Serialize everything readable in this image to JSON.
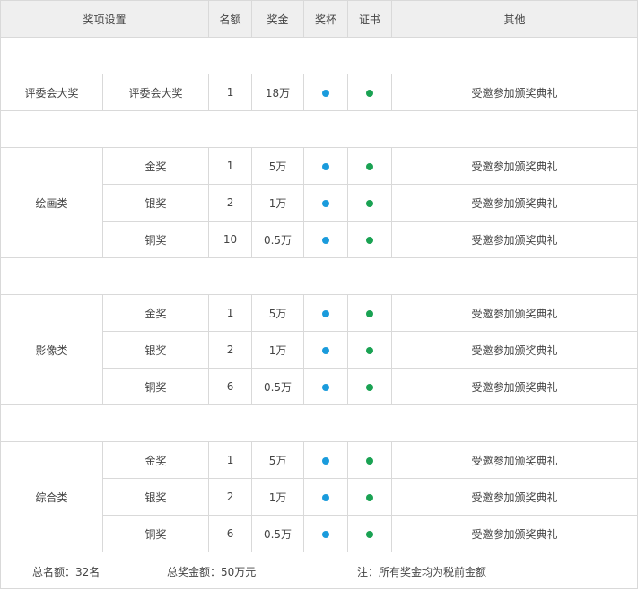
{
  "header": {
    "category": "奖项设置",
    "count": "名额",
    "prize": "奖金",
    "trophy": "奖杯",
    "certificate": "证书",
    "other": "其他"
  },
  "jury": {
    "group": "评委会大奖",
    "name": "评委会大奖",
    "count": "1",
    "prize": "18万",
    "other": "受邀参加颁奖典礼"
  },
  "groups": [
    {
      "name": "绘画类",
      "rows": [
        {
          "name": "金奖",
          "count": "1",
          "prize": "5万",
          "other": "受邀参加颁奖典礼"
        },
        {
          "name": "银奖",
          "count": "2",
          "prize": "1万",
          "other": "受邀参加颁奖典礼"
        },
        {
          "name": "铜奖",
          "count": "10",
          "prize": "0.5万",
          "other": "受邀参加颁奖典礼"
        }
      ]
    },
    {
      "name": "影像类",
      "rows": [
        {
          "name": "金奖",
          "count": "1",
          "prize": "5万",
          "other": "受邀参加颁奖典礼"
        },
        {
          "name": "银奖",
          "count": "2",
          "prize": "1万",
          "other": "受邀参加颁奖典礼"
        },
        {
          "name": "铜奖",
          "count": "6",
          "prize": "0.5万",
          "other": "受邀参加颁奖典礼"
        }
      ]
    },
    {
      "name": "综合类",
      "rows": [
        {
          "name": "金奖",
          "count": "1",
          "prize": "5万",
          "other": "受邀参加颁奖典礼"
        },
        {
          "name": "银奖",
          "count": "2",
          "prize": "1万",
          "other": "受邀参加颁奖典礼"
        },
        {
          "name": "铜奖",
          "count": "6",
          "prize": "0.5万",
          "other": "受邀参加颁奖典礼"
        }
      ]
    }
  ],
  "footer": {
    "total_count": "总名额：32名",
    "total_prize": "总奖金额：50万元",
    "note": "注：所有奖金均为税前金额"
  },
  "colors": {
    "trophy_dot": "#1a9bdc",
    "certificate_dot": "#1aa253",
    "header_bg": "#efefef",
    "border": "#d9d9d9"
  }
}
